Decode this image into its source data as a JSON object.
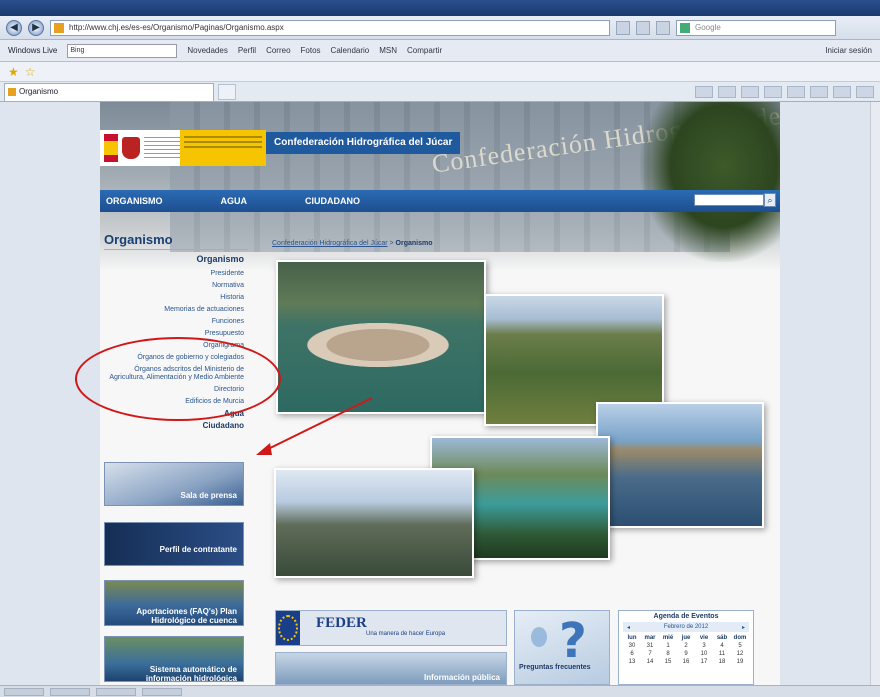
{
  "browser": {
    "url": "http://www.chj.es/es-es/Organismo/Paginas/Organismo.aspx",
    "search_placeholder": "Google",
    "links_label": "Windows Live",
    "links_input": "Bing",
    "links": [
      "Novedades",
      "Perfil",
      "Correo",
      "Fotos",
      "Calendario",
      "MSN",
      "Compartir"
    ],
    "signin": "Iniciar sesión",
    "tab_title": "Organismo"
  },
  "site": {
    "org_title": "Confederación Hidrográfica del Júcar",
    "building_text": "Confederación Hidrográfica del Júcar",
    "nav": [
      "ORGANISMO",
      "AGUA",
      "CIUDADANO"
    ],
    "section_title": "Organismo",
    "breadcrumb": "Confederación Hidrográfica del Júcar",
    "breadcrumb_sep": " > ",
    "breadcrumb_current": "Organismo",
    "menu_head": "Organismo",
    "menu_items": [
      "Presidente",
      "Normativa",
      "Historia",
      "Memorias de actuaciones",
      "Funciones",
      "Presupuesto",
      "Organigrama",
      "Órganos de gobierno y colegiados",
      "Órganos adscritos del Ministerio de Agricultura, Alimentación y Medio Ambiente",
      "Directorio",
      "Edificios de Murcia"
    ],
    "menu_plain": [
      "Agua",
      "Ciudadano"
    ],
    "banners": [
      "Sala de prensa",
      "Perfil de contratante",
      "Aportaciones (FAQ's) Plan Hidrológico de cuenca",
      "Sistema automático de información hidrológica"
    ],
    "feder_title": "FEDER",
    "feder_sub": "Una manera de hacer Europa",
    "public_info": "Información pública",
    "faq_label": "Preguntas frecuentes",
    "agenda": {
      "title": "Agenda de Eventos",
      "month": "Febrero de 2012",
      "days": [
        "lun",
        "mar",
        "mié",
        "jue",
        "vie",
        "sáb",
        "dom"
      ],
      "weeks": [
        [
          "30",
          "31",
          "1",
          "2",
          "3",
          "4",
          "5"
        ],
        [
          "6",
          "7",
          "8",
          "9",
          "10",
          "11",
          "12"
        ],
        [
          "13",
          "14",
          "15",
          "16",
          "17",
          "18",
          "19"
        ]
      ]
    }
  }
}
